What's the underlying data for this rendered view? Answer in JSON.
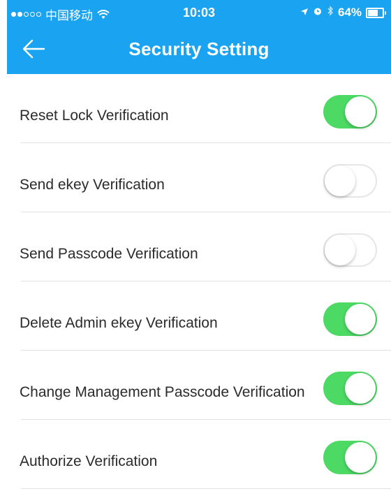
{
  "status_bar": {
    "carrier": "中国移动",
    "time": "10:03",
    "battery": "64%"
  },
  "nav": {
    "title": "Security Setting",
    "back_icon": "arrow-left-icon"
  },
  "colors": {
    "header_bg": "#1AA3F0",
    "toggle_on": "#4CD964",
    "toggle_off_border": "#e6e6e6"
  },
  "settings": [
    {
      "label": "Reset Lock Verification",
      "enabled": true
    },
    {
      "label": "Send ekey Verification",
      "enabled": false
    },
    {
      "label": "Send Passcode Verification",
      "enabled": false
    },
    {
      "label": "Delete Admin ekey Verification",
      "enabled": true
    },
    {
      "label": "Change Management Passcode Verification",
      "enabled": true
    },
    {
      "label": "Authorize Verification",
      "enabled": true
    }
  ]
}
